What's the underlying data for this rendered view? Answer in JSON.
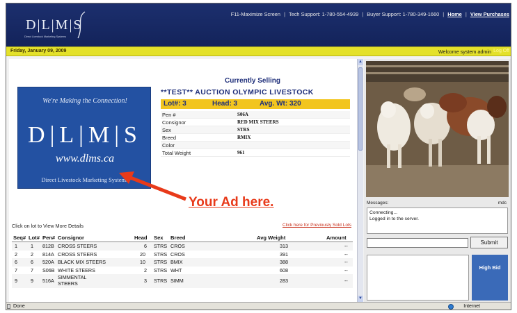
{
  "header": {
    "logo_text": "D|L|M|S",
    "logo_sub": "Direct Livestock Marketing Systems",
    "links": {
      "maximize": "F11-Maximize Screen",
      "tech_support": "Tech Support: 1-780-554-4939",
      "buyer_support": "Buyer Support: 1-780-349-1660",
      "home": "Home",
      "view_purchases": "View Purchases"
    },
    "separator": "|"
  },
  "datebar": {
    "date": "Friday, January 09, 2009",
    "welcome": "Welcome system admin",
    "logout": "Log Off"
  },
  "ad": {
    "tagline": "We're Making the Connection!",
    "logo": "D|L|M|S",
    "website": "www.dlms.ca",
    "footer": "Direct Livestock Marketing Systems",
    "your_ad": "Your Ad here."
  },
  "selling": {
    "title": "Currently Selling",
    "auction": "**TEST** AUCTION OLYMPIC LIVESTOCK",
    "lot": "Lot#: 3",
    "head": "Head: 3",
    "avg_wt": "Avg. Wt: 320",
    "details": [
      {
        "key": "Pen #",
        "value": "S06A"
      },
      {
        "key": "Consignor",
        "value": "RED MIX STEERS"
      },
      {
        "key": "Sex",
        "value": "STRS"
      },
      {
        "key": "Breed",
        "value": "RMIX"
      },
      {
        "key": "Color",
        "value": ""
      },
      {
        "key": "Total Weight",
        "value": "961"
      }
    ]
  },
  "lots": {
    "click_note": "Click on lot to View More Details",
    "prev_link": "Click here for Previously Sold Lots",
    "columns": [
      "Seq#",
      "Lot#",
      "Pen#",
      "Consignor",
      "Head",
      "Sex",
      "Breed",
      "Avg Weight",
      "Amount"
    ],
    "rows": [
      {
        "seq": "1",
        "lot": "1",
        "pen": "812B",
        "consignor": "CROSS STEERS",
        "head": "6",
        "sex": "STRS",
        "breed": "CROS",
        "avg": "313",
        "amount": "--"
      },
      {
        "seq": "2",
        "lot": "2",
        "pen": "814A",
        "consignor": "CROSS STEERS",
        "head": "20",
        "sex": "STRS",
        "breed": "CROS",
        "avg": "391",
        "amount": "--"
      },
      {
        "seq": "6",
        "lot": "6",
        "pen": "520A",
        "consignor": "BLACK MIX STEERS",
        "head": "10",
        "sex": "STRS",
        "breed": "BMIX",
        "avg": "388",
        "amount": "--"
      },
      {
        "seq": "7",
        "lot": "7",
        "pen": "S06B",
        "consignor": "WHITE STEERS",
        "head": "2",
        "sex": "STRS",
        "breed": "WHT",
        "avg": "608",
        "amount": "--"
      },
      {
        "seq": "9",
        "lot": "9",
        "pen": "516A",
        "consignor": "SIMMENTAL STEERS",
        "head": "3",
        "sex": "STRS",
        "breed": "SIMM",
        "avg": "283",
        "amount": "--"
      }
    ]
  },
  "chat": {
    "label": "Messages:",
    "status": "mdc",
    "lines": [
      "Connecting...",
      "Logged in to the server."
    ],
    "submit": "Submit"
  },
  "bid": {
    "label": "High Bid"
  },
  "statusbar": {
    "done": "Done",
    "zone": "Internet"
  },
  "colors": {
    "header_bg": "#13235a",
    "date_bar": "#e4e12a",
    "lot_bar": "#f2c51e",
    "ad_blue": "#2351a2",
    "accent_red": "#e83a1a"
  }
}
